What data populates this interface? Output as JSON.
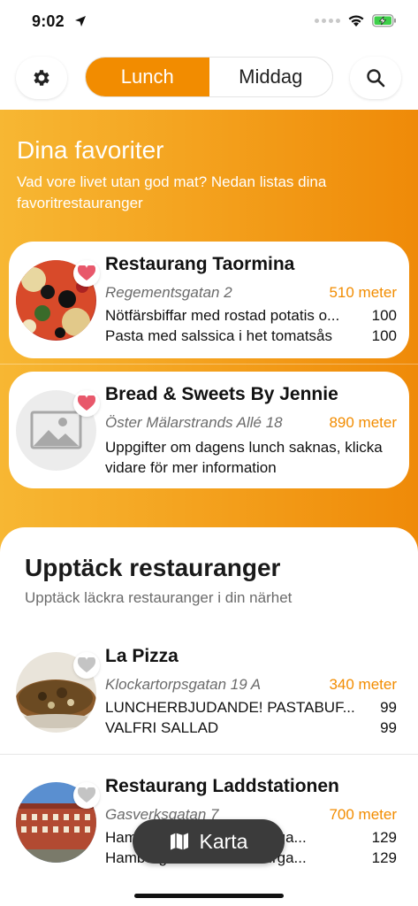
{
  "status_bar": {
    "time": "9:02"
  },
  "top_bar": {
    "segments": [
      {
        "label": "Lunch",
        "active": true
      },
      {
        "label": "Middag",
        "active": false
      }
    ],
    "accent_color": "#f28c00"
  },
  "favorites": {
    "title": "Dina favoriter",
    "subtitle": "Vad vore livet utan god mat? Nedan listas dina favoritrestauranger",
    "items": [
      {
        "name": "Restaurang Taormina",
        "address": "Regementsgatan 2",
        "distance": "510 meter",
        "favorite": true,
        "image": "pizza-photo",
        "dishes": [
          {
            "title": "Nötfärsbiffar med rostad potatis o...",
            "price": "100"
          },
          {
            "title": "Pasta med salssica i het tomatsås",
            "price": "100"
          }
        ]
      },
      {
        "name": "Bread & Sweets By Jennie",
        "address": "Öster Mälarstrands Allé 18",
        "distance": "890 meter",
        "favorite": true,
        "image": "placeholder-image-icon",
        "note": "Uppgifter om dagens lunch saknas, klicka vidare för mer information"
      }
    ]
  },
  "discover": {
    "title": "Upptäck restauranger",
    "subtitle": "Upptäck läckra restauranger i din närhet",
    "items": [
      {
        "name": "La Pizza",
        "address": "Klockartorpsgatan 19 A",
        "distance": "340 meter",
        "favorite": false,
        "image": "pizza-photo",
        "dishes": [
          {
            "title": "LUNCHERBJUDANDE! PASTABUF...",
            "price": "99"
          },
          {
            "title": "VALFRI SALLAD",
            "price": "99"
          }
        ]
      },
      {
        "name": "Restaurang Laddstationen",
        "address": "Gasverksgatan 7",
        "distance": "700 meter",
        "favorite": false,
        "image": "building-photo",
        "dishes": [
          {
            "title": "Hamburgare med hamburga...",
            "price": "129"
          },
          {
            "title": "Hamburgare med hamburga...",
            "price": "129"
          }
        ]
      }
    ]
  },
  "map_button": {
    "label": "Karta"
  }
}
